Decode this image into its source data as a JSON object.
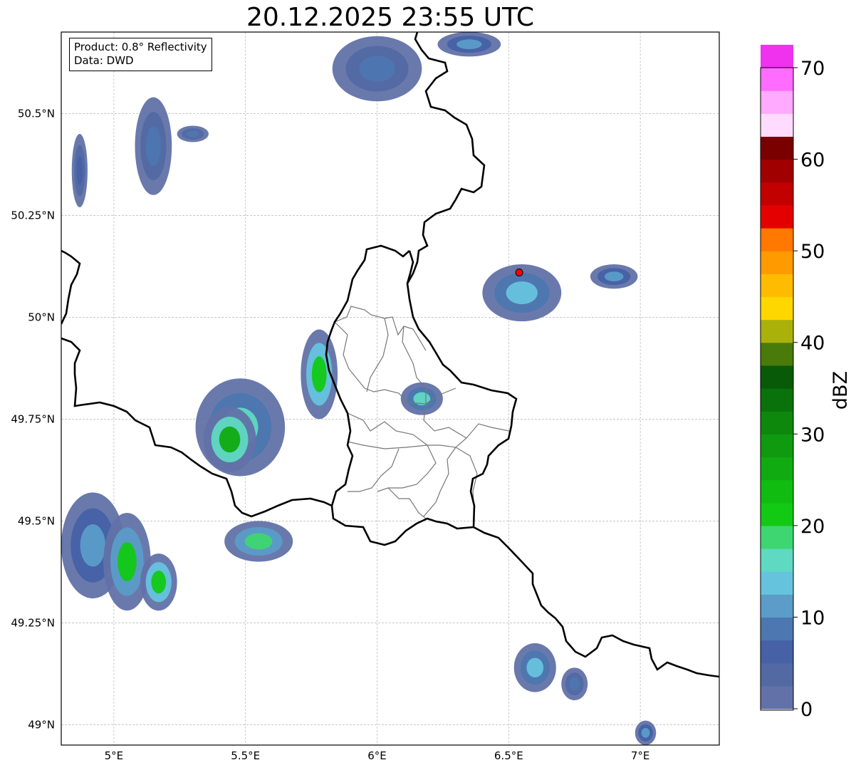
{
  "title": "20.12.2025 23:55 UTC",
  "info": {
    "product": "Product: 0.8° Reflectivity",
    "source": "Data: DWD"
  },
  "axes": {
    "lat_labels": [
      "50.5°N",
      "50.25°N",
      "50°N",
      "49.75°N",
      "49.5°N",
      "49.25°N",
      "49°N"
    ],
    "lat_values": [
      50.5,
      50.25,
      50.0,
      49.75,
      49.5,
      49.25,
      49.0
    ],
    "lon_labels": [
      "5°E",
      "5.5°E",
      "6°E",
      "6.5°E",
      "7°E"
    ],
    "lon_values": [
      5.0,
      5.5,
      6.0,
      6.5,
      7.0
    ],
    "lon_range": [
      4.8,
      7.3
    ],
    "lat_range": [
      48.95,
      50.7
    ],
    "gridlines": true
  },
  "colorbar": {
    "label": "dBZ",
    "tick_labels": [
      "0",
      "10",
      "20",
      "30",
      "40",
      "50",
      "60",
      "70"
    ],
    "tick_values": [
      0,
      10,
      20,
      30,
      40,
      50,
      60,
      70
    ],
    "range": [
      0,
      70
    ],
    "step": 2.5,
    "colors": [
      "#6272a8",
      "#5369a4",
      "#4661a6",
      "#4d77b0",
      "#5b9cc8",
      "#66c3de",
      "#5fd9c2",
      "#3ed671",
      "#12c914",
      "#11bc11",
      "#10ab10",
      "#0f9a0f",
      "#0d880d",
      "#0a720a",
      "#085a08",
      "#4a7a0a",
      "#aab20a",
      "#ffd700",
      "#ffbb00",
      "#ff9a00",
      "#ff7800",
      "#e50000",
      "#c20000",
      "#a10000",
      "#7a0000",
      "#ffdcff",
      "#ffaaff",
      "#ff6cff",
      "#ee32ee"
    ]
  },
  "radar_site": {
    "lon": 6.54,
    "lat": 50.11,
    "color": "#ff0000"
  },
  "echo_cells": [
    {
      "lon": 4.92,
      "lat": 49.44,
      "rx": 0.12,
      "ry": 0.13,
      "dbz": 10
    },
    {
      "lon": 5.05,
      "lat": 49.4,
      "rx": 0.09,
      "ry": 0.12,
      "dbz": 20
    },
    {
      "lon": 5.17,
      "lat": 49.35,
      "rx": 0.07,
      "ry": 0.07,
      "dbz": 22
    },
    {
      "lon": 5.48,
      "lat": 49.73,
      "rx": 0.17,
      "ry": 0.12,
      "dbz": 15
    },
    {
      "lon": 5.44,
      "lat": 49.7,
      "rx": 0.1,
      "ry": 0.08,
      "dbz": 25
    },
    {
      "lon": 5.78,
      "lat": 49.86,
      "rx": 0.07,
      "ry": 0.11,
      "dbz": 22
    },
    {
      "lon": 5.55,
      "lat": 49.45,
      "rx": 0.13,
      "ry": 0.05,
      "dbz": 18
    },
    {
      "lon": 5.15,
      "lat": 50.42,
      "rx": 0.07,
      "ry": 0.12,
      "dbz": 8
    },
    {
      "lon": 4.87,
      "lat": 50.36,
      "rx": 0.03,
      "ry": 0.09,
      "dbz": 6
    },
    {
      "lon": 5.3,
      "lat": 50.45,
      "rx": 0.06,
      "ry": 0.02,
      "dbz": 8
    },
    {
      "lon": 6.0,
      "lat": 50.61,
      "rx": 0.17,
      "ry": 0.08,
      "dbz": 8
    },
    {
      "lon": 6.35,
      "lat": 50.67,
      "rx": 0.12,
      "ry": 0.03,
      "dbz": 10
    },
    {
      "lon": 6.55,
      "lat": 50.06,
      "rx": 0.15,
      "ry": 0.07,
      "dbz": 14
    },
    {
      "lon": 6.9,
      "lat": 50.1,
      "rx": 0.09,
      "ry": 0.03,
      "dbz": 10
    },
    {
      "lon": 6.17,
      "lat": 49.8,
      "rx": 0.08,
      "ry": 0.04,
      "dbz": 16
    },
    {
      "lon": 6.6,
      "lat": 49.14,
      "rx": 0.08,
      "ry": 0.06,
      "dbz": 14
    },
    {
      "lon": 6.75,
      "lat": 49.1,
      "rx": 0.05,
      "ry": 0.04,
      "dbz": 8
    },
    {
      "lon": 7.02,
      "lat": 48.98,
      "rx": 0.04,
      "ry": 0.03,
      "dbz": 10
    }
  ]
}
